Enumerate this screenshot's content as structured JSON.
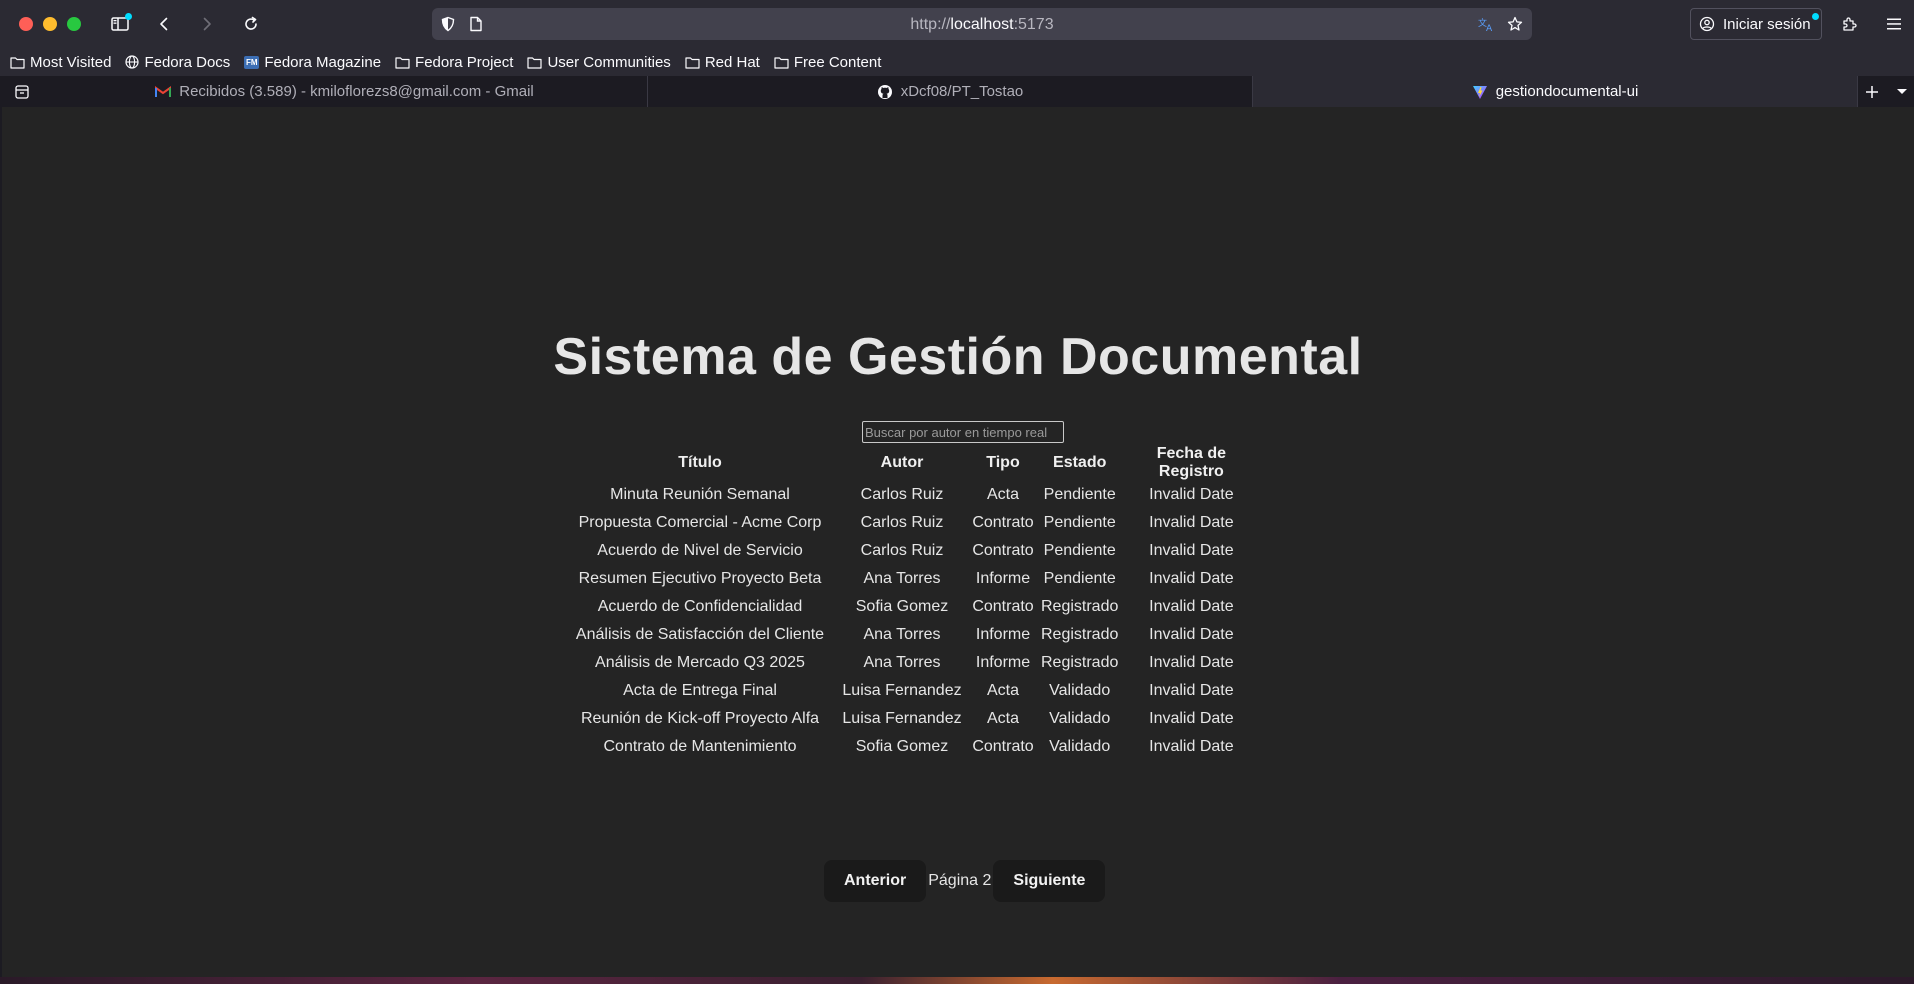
{
  "browser": {
    "url_scheme": "http://",
    "url_host": "localhost",
    "url_port": ":5173",
    "signin_label": "Iniciar sesión",
    "bookmarks": [
      {
        "label": "Most Visited",
        "icon": "folder-icon"
      },
      {
        "label": "Fedora Docs",
        "icon": "globe-icon"
      },
      {
        "label": "Fedora Magazine",
        "icon": "fedora-magazine-icon"
      },
      {
        "label": "Fedora Project",
        "icon": "folder-icon"
      },
      {
        "label": "User Communities",
        "icon": "folder-icon"
      },
      {
        "label": "Red Hat",
        "icon": "folder-icon"
      },
      {
        "label": "Free Content",
        "icon": "folder-icon"
      }
    ],
    "tabs": [
      {
        "label": "Recibidos (3.589) - kmiloflorezs8@gmail.com - Gmail",
        "icon": "gmail-icon",
        "active": false
      },
      {
        "label": "xDcf08/PT_Tostao",
        "icon": "github-icon",
        "active": false
      },
      {
        "label": "gestiondocumental-ui",
        "icon": "vite-icon",
        "active": true
      }
    ],
    "fedora_magazine_badge": "FM"
  },
  "app": {
    "title": "Sistema de Gestión Documental",
    "search_placeholder": "Buscar por autor en tiempo real",
    "columns": [
      "Título",
      "Autor",
      "Tipo",
      "Estado",
      "Fecha de Registro"
    ],
    "rows": [
      [
        "Minuta Reunión Semanal",
        "Carlos Ruiz",
        "Acta",
        "Pendiente",
        "Invalid Date"
      ],
      [
        "Propuesta Comercial - Acme Corp",
        "Carlos Ruiz",
        "Contrato",
        "Pendiente",
        "Invalid Date"
      ],
      [
        "Acuerdo de Nivel de Servicio",
        "Carlos Ruiz",
        "Contrato",
        "Pendiente",
        "Invalid Date"
      ],
      [
        "Resumen Ejecutivo Proyecto Beta",
        "Ana Torres",
        "Informe",
        "Pendiente",
        "Invalid Date"
      ],
      [
        "Acuerdo de Confidencialidad",
        "Sofia Gomez",
        "Contrato",
        "Registrado",
        "Invalid Date"
      ],
      [
        "Análisis de Satisfacción del Cliente",
        "Ana Torres",
        "Informe",
        "Registrado",
        "Invalid Date"
      ],
      [
        "Análisis de Mercado Q3 2025",
        "Ana Torres",
        "Informe",
        "Registrado",
        "Invalid Date"
      ],
      [
        "Acta de Entrega Final",
        "Luisa Fernandez",
        "Acta",
        "Validado",
        "Invalid Date"
      ],
      [
        "Reunión de Kick-off Proyecto Alfa",
        "Luisa Fernandez",
        "Acta",
        "Validado",
        "Invalid Date"
      ],
      [
        "Contrato de Mantenimiento",
        "Sofia Gomez",
        "Contrato",
        "Validado",
        "Invalid Date"
      ]
    ],
    "pager": {
      "prev_label": "Anterior",
      "page_label": "Página 2",
      "next_label": "Siguiente"
    }
  },
  "colors": {
    "page_bg": "#242424",
    "chrome_bg": "#2b2a33",
    "text": "#e6e6e6"
  }
}
